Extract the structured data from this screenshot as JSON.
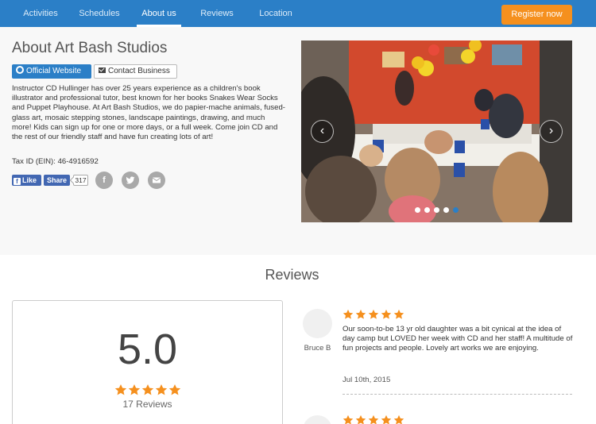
{
  "nav": {
    "items": [
      {
        "label": "Activities"
      },
      {
        "label": "Schedules"
      },
      {
        "label": "About us"
      },
      {
        "label": "Reviews"
      },
      {
        "label": "Location"
      }
    ],
    "active": "About us",
    "register_label": "Register now"
  },
  "about": {
    "title": "About Art Bash Studios",
    "official_website_label": "Official Website",
    "contact_label": "Contact Business",
    "description": "Instructor CD Hullinger has over 25 years experience as a children's book illustrator and professional tutor, best known for her books Snakes Wear Socks and Puppet Playhouse. At Art Bash Studios, we do papier-mache animals, fused-glass art, mosaic stepping stones, landscape paintings, drawing, and much more! Kids can sign up for one or more days, or a full week. Come join CD and the rest of our friendly staff and have fun creating lots of art!",
    "tax_id": "Tax ID (EIN): 46-4916592",
    "social": {
      "like_label": "Like",
      "share_label": "Share",
      "count": "317",
      "share_icons": [
        "facebook-icon",
        "twitter-icon",
        "email-icon"
      ]
    }
  },
  "carousel": {
    "prev_glyph": "‹",
    "next_glyph": "›",
    "slide_count": 5,
    "active_slide": 5
  },
  "reviews": {
    "heading": "Reviews",
    "score": "5.0",
    "rating": 5,
    "count_label": "17 Reviews",
    "items": [
      {
        "name": "Bruce B",
        "rating": 5,
        "text": "Our soon-to-be 13 yr old daughter was a bit cynical at the idea of day camp but LOVED her week with CD and her staff! A multitude of fun projects and people. Lovely art works we are enjoying.",
        "date": "Jul 10th, 2015"
      },
      {
        "rating": 5
      }
    ]
  },
  "colors": {
    "brand_blue": "#2b7fc7",
    "register_orange": "#f5901e",
    "star_orange": "#f5901e"
  }
}
